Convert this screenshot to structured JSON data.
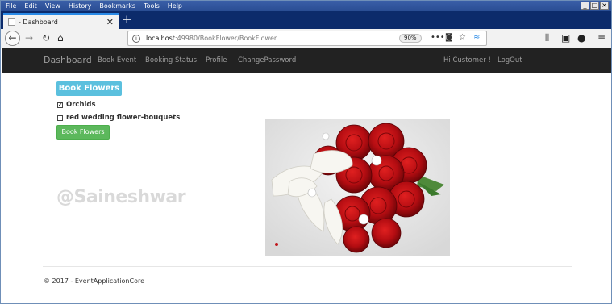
{
  "browser": {
    "menu": [
      "File",
      "Edit",
      "View",
      "History",
      "Bookmarks",
      "Tools",
      "Help"
    ],
    "tab_title": "- Dashboard",
    "url_host": "localhost",
    "url_path": ":49980/BookFlower/BookFlower",
    "zoom": "90%"
  },
  "navbar": {
    "brand": "Dashboard",
    "links": [
      "Book Event",
      "Booking Status",
      "Profile",
      "ChangePassword"
    ],
    "greeting": "Hi Customer !",
    "logout": "LogOut"
  },
  "main": {
    "heading": "Book Flowers",
    "options": [
      {
        "label": "Orchids",
        "checked": true
      },
      {
        "label": "red wedding flower-bouquets",
        "checked": false
      }
    ],
    "submit_label": "Book Flowers",
    "watermark": "@Saineshwar"
  },
  "footer": {
    "text": "© 2017 - EventApplicationCore"
  }
}
